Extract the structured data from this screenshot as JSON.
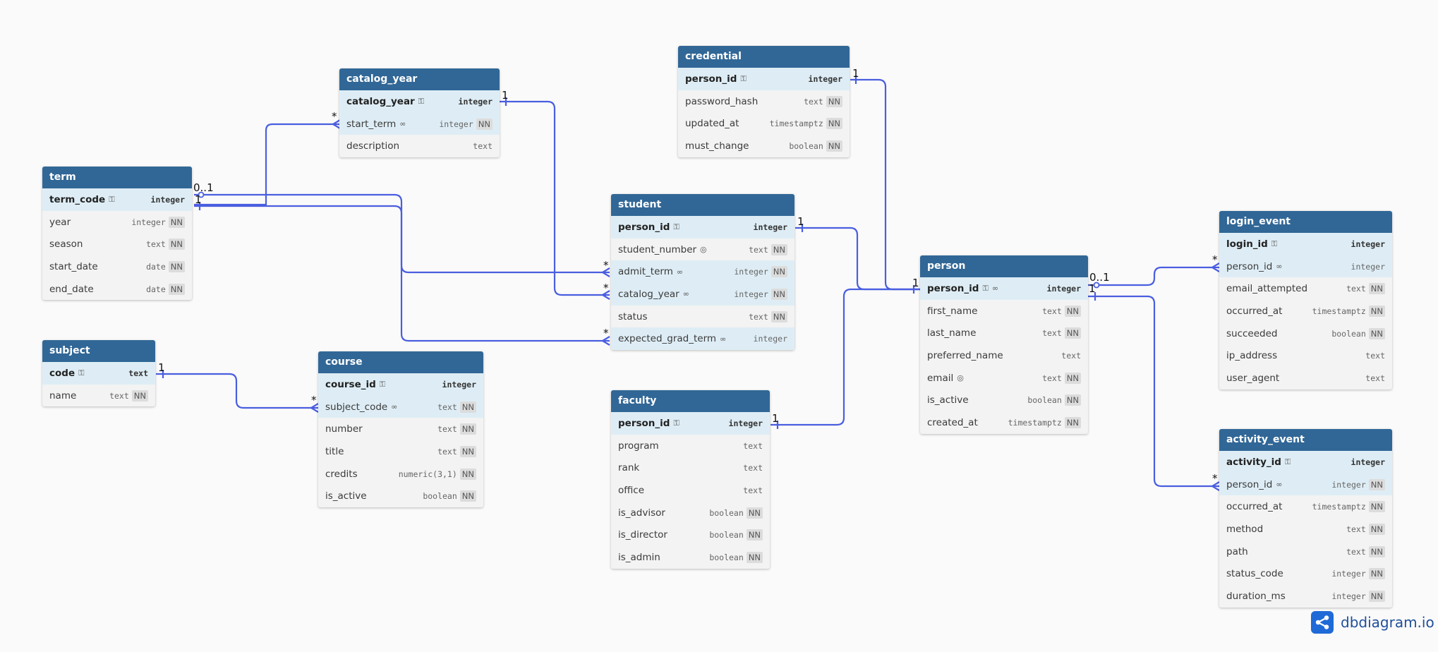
{
  "tables": [
    {
      "id": "term",
      "name": "term",
      "fields": [
        {
          "name": "term_code",
          "type": "integer",
          "pk": true,
          "key": true
        },
        {
          "name": "year",
          "type": "integer",
          "nn": true
        },
        {
          "name": "season",
          "type": "text",
          "nn": true
        },
        {
          "name": "start_date",
          "type": "date",
          "nn": true
        },
        {
          "name": "end_date",
          "type": "date",
          "nn": true
        }
      ]
    },
    {
      "id": "subject",
      "name": "subject",
      "fields": [
        {
          "name": "code",
          "type": "text",
          "pk": true,
          "key": true
        },
        {
          "name": "name",
          "type": "text",
          "nn": true
        }
      ]
    },
    {
      "id": "catalog_year",
      "name": "catalog_year",
      "fields": [
        {
          "name": "catalog_year",
          "type": "integer",
          "pk": true,
          "key": true
        },
        {
          "name": "start_term",
          "type": "integer",
          "nn": true,
          "fk": true,
          "ref": true
        },
        {
          "name": "description",
          "type": "text"
        }
      ]
    },
    {
      "id": "course",
      "name": "course",
      "fields": [
        {
          "name": "course_id",
          "type": "integer",
          "pk": true,
          "key": true
        },
        {
          "name": "subject_code",
          "type": "text",
          "nn": true,
          "fk": true,
          "ref": true
        },
        {
          "name": "number",
          "type": "text",
          "nn": true
        },
        {
          "name": "title",
          "type": "text",
          "nn": true
        },
        {
          "name": "credits",
          "type": "numeric(3,1)",
          "nn": true
        },
        {
          "name": "is_active",
          "type": "boolean",
          "nn": true
        }
      ]
    },
    {
      "id": "credential",
      "name": "credential",
      "fields": [
        {
          "name": "person_id",
          "type": "integer",
          "pk": true,
          "key": true
        },
        {
          "name": "password_hash",
          "type": "text",
          "nn": true
        },
        {
          "name": "updated_at",
          "type": "timestamptz",
          "nn": true
        },
        {
          "name": "must_change",
          "type": "boolean",
          "nn": true
        }
      ]
    },
    {
      "id": "student",
      "name": "student",
      "fields": [
        {
          "name": "person_id",
          "type": "integer",
          "pk": true,
          "key": true
        },
        {
          "name": "student_number",
          "type": "text",
          "nn": true,
          "unique": true
        },
        {
          "name": "admit_term",
          "type": "integer",
          "nn": true,
          "fk": true,
          "ref": true
        },
        {
          "name": "catalog_year",
          "type": "integer",
          "nn": true,
          "fk": true,
          "ref": true
        },
        {
          "name": "status",
          "type": "text",
          "nn": true
        },
        {
          "name": "expected_grad_term",
          "type": "integer",
          "fk": true,
          "ref": true
        }
      ]
    },
    {
      "id": "faculty",
      "name": "faculty",
      "fields": [
        {
          "name": "person_id",
          "type": "integer",
          "pk": true,
          "key": true
        },
        {
          "name": "program",
          "type": "text"
        },
        {
          "name": "rank",
          "type": "text"
        },
        {
          "name": "office",
          "type": "text"
        },
        {
          "name": "is_advisor",
          "type": "boolean",
          "nn": true
        },
        {
          "name": "is_director",
          "type": "boolean",
          "nn": true
        },
        {
          "name": "is_admin",
          "type": "boolean",
          "nn": true
        }
      ]
    },
    {
      "id": "person",
      "name": "person",
      "fields": [
        {
          "name": "person_id",
          "type": "integer",
          "pk": true,
          "key": true,
          "ref": true
        },
        {
          "name": "first_name",
          "type": "text",
          "nn": true
        },
        {
          "name": "last_name",
          "type": "text",
          "nn": true
        },
        {
          "name": "preferred_name",
          "type": "text"
        },
        {
          "name": "email",
          "type": "text",
          "nn": true,
          "unique": true
        },
        {
          "name": "is_active",
          "type": "boolean",
          "nn": true
        },
        {
          "name": "created_at",
          "type": "timestamptz",
          "nn": true
        }
      ]
    },
    {
      "id": "login_event",
      "name": "login_event",
      "fields": [
        {
          "name": "login_id",
          "type": "integer",
          "pk": true,
          "key": true
        },
        {
          "name": "person_id",
          "type": "integer",
          "fk": true,
          "ref": true
        },
        {
          "name": "email_attempted",
          "type": "text",
          "nn": true
        },
        {
          "name": "occurred_at",
          "type": "timestamptz",
          "nn": true
        },
        {
          "name": "succeeded",
          "type": "boolean",
          "nn": true
        },
        {
          "name": "ip_address",
          "type": "text"
        },
        {
          "name": "user_agent",
          "type": "text"
        }
      ]
    },
    {
      "id": "activity_event",
      "name": "activity_event",
      "fields": [
        {
          "name": "activity_id",
          "type": "integer",
          "pk": true,
          "key": true
        },
        {
          "name": "person_id",
          "type": "integer",
          "nn": true,
          "fk": true,
          "ref": true
        },
        {
          "name": "occurred_at",
          "type": "timestamptz",
          "nn": true
        },
        {
          "name": "method",
          "type": "text",
          "nn": true
        },
        {
          "name": "path",
          "type": "text",
          "nn": true
        },
        {
          "name": "status_code",
          "type": "integer",
          "nn": true
        },
        {
          "name": "duration_ms",
          "type": "integer",
          "nn": true
        }
      ]
    }
  ],
  "nn_label": "NN",
  "cardinality": {
    "cat_start_term": "*",
    "cat_pk": "1",
    "term_opt": "0..1",
    "term_one": "1",
    "cred_pk": "1",
    "student_pk": "1",
    "admit": "*",
    "catyear": "*",
    "expgrad": "*",
    "subject_pk": "1",
    "course_subj": "*",
    "person_pk": "1",
    "person_opt": "0..1",
    "person_one": "1",
    "faculty_pk": "1",
    "login_fk": "*",
    "activity_fk": "*"
  },
  "brand": {
    "name": "dbdiagram.io",
    "icon": "share-icon",
    "color": "#1f6ad6"
  },
  "link_color": "#4a5ee0",
  "header_color": "#316796"
}
